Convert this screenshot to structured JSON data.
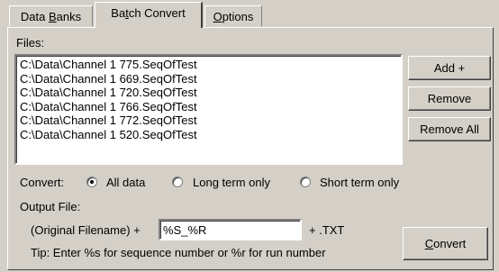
{
  "tabs": [
    {
      "label_pre": "Data ",
      "label_u": "B",
      "label_post": "anks"
    },
    {
      "label_pre": "Ba",
      "label_u": "t",
      "label_post": "ch Convert"
    },
    {
      "label_pre": "",
      "label_u": "O",
      "label_post": "ptions"
    }
  ],
  "files": {
    "label": "Files:",
    "items": [
      "C:\\Data\\Channel 1 775.SeqOfTest",
      "C:\\Data\\Channel 1 669.SeqOfTest",
      "C:\\Data\\Channel 1 720.SeqOfTest",
      "C:\\Data\\Channel 1 766.SeqOfTest",
      "C:\\Data\\Channel 1 772.SeqOfTest",
      "C:\\Data\\Channel 1 520.SeqOfTest"
    ]
  },
  "buttons": {
    "add": "Add +",
    "remove": "Remove",
    "remove_all": "Remove All",
    "convert_pre": "",
    "convert_u": "C",
    "convert_post": "onvert"
  },
  "convert_mode": {
    "label": "Convert:",
    "options": [
      "All data",
      "Long term only",
      "Short term only"
    ],
    "selected": "All data"
  },
  "output": {
    "label": "Output File:",
    "prefix": "(Original Filename) +",
    "value": "%S_%R",
    "suffix": "+ .TXT",
    "tip": "Tip: Enter %s for sequence number or %r for run number"
  }
}
